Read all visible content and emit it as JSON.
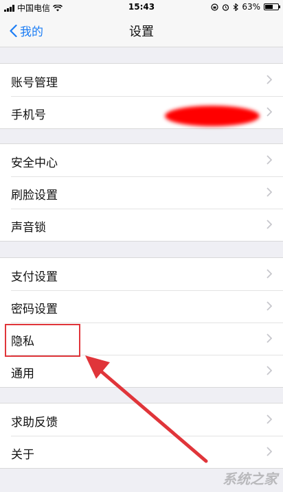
{
  "status_bar": {
    "carrier": "中国电信",
    "time": "15:43",
    "battery_percent": "63%",
    "battery_level": 0.63,
    "icons": [
      "signal-icon",
      "wifi-icon",
      "orientation-lock-icon",
      "alarm-icon",
      "bluetooth-icon",
      "battery-icon"
    ]
  },
  "nav": {
    "back_label": "我的",
    "title": "设置"
  },
  "groups": [
    {
      "items": [
        {
          "label": "账号管理"
        },
        {
          "label": "手机号"
        }
      ]
    },
    {
      "items": [
        {
          "label": "安全中心"
        },
        {
          "label": "刷脸设置"
        },
        {
          "label": "声音锁"
        }
      ]
    },
    {
      "items": [
        {
          "label": "支付设置"
        },
        {
          "label": "密码设置"
        },
        {
          "label": "隐私"
        },
        {
          "label": "通用"
        }
      ]
    },
    {
      "items": [
        {
          "label": "求助反馈"
        },
        {
          "label": "关于"
        }
      ]
    }
  ],
  "colors": {
    "accent": "#1a7cf5",
    "background": "#efeff4",
    "highlight": "#e0353a",
    "redaction": "#ff0000"
  },
  "watermark": "系统之家"
}
